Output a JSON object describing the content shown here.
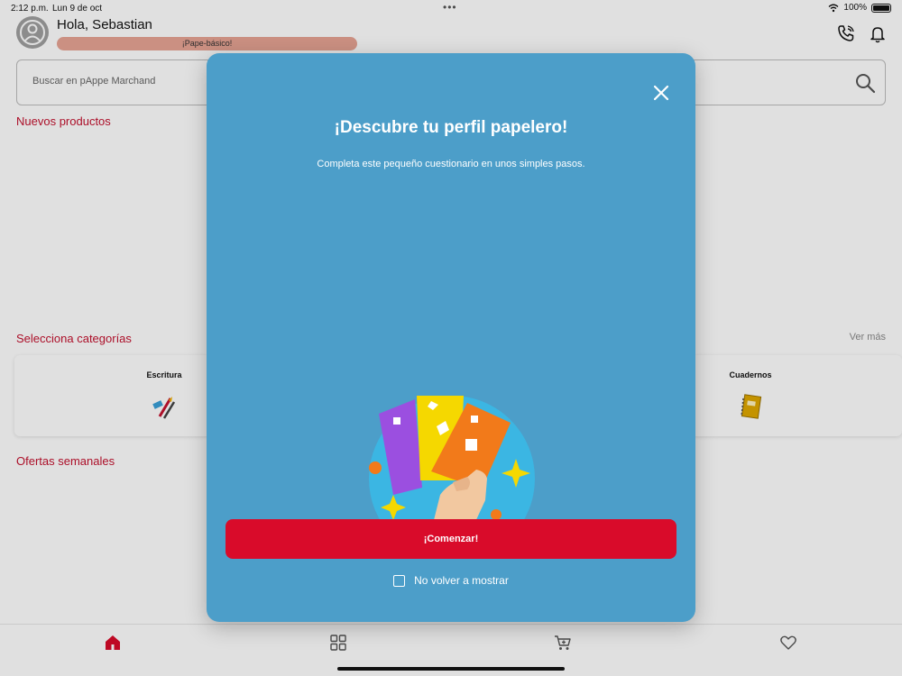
{
  "status_bar": {
    "time": "2:12 p.m.",
    "date": "Lun 9 de oct",
    "battery": "100%"
  },
  "header": {
    "greeting": "Hola, Sebastian",
    "level_badge": "¡Pape-básico!"
  },
  "search": {
    "placeholder": "Buscar en pAppe Marchand"
  },
  "sections": {
    "new_products": "Nuevos productos",
    "categories": "Selecciona categorías",
    "see_more": "Ver más",
    "weekly_offers": "Ofertas semanales"
  },
  "categories": [
    {
      "label": "Escritura",
      "icon": "pens-icon"
    },
    {
      "label": "Cuadernos",
      "icon": "notebook-icon"
    }
  ],
  "bottom_nav": [
    {
      "icon": "home-icon",
      "active": true
    },
    {
      "icon": "grid-icon",
      "active": false
    },
    {
      "icon": "cart-icon",
      "active": false
    },
    {
      "icon": "heart-icon",
      "active": false
    }
  ],
  "modal": {
    "title": "¡Descubre tu perfil papelero!",
    "subtitle": "Completa este pequeño cuestionario en unos simples pasos.",
    "start_button": "¡Comenzar!",
    "dont_show_label": "No volver a mostrar",
    "dont_show_checked": false
  },
  "colors": {
    "brand_red": "#c4122f",
    "button_red": "#d90b2a",
    "modal_blue": "#4c9ec9",
    "badge": "#e8a495"
  }
}
